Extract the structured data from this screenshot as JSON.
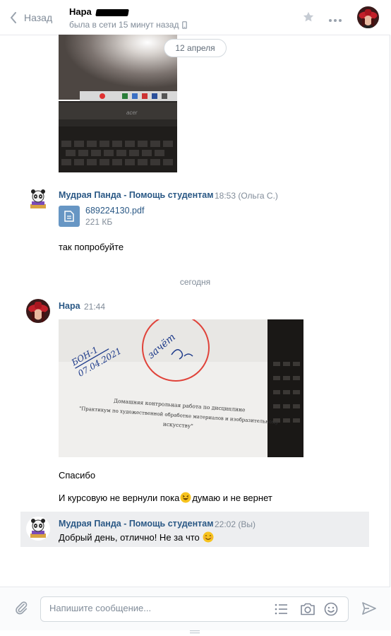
{
  "header": {
    "back_label": "Назад",
    "peer_name": "Нара",
    "peer_status": "была в сети 15 минут назад"
  },
  "messages": {
    "date_label_april": "12 апреля",
    "panda_sender": "Мудрая Панда - Помощь студентам",
    "panda_time_1": "18:53 (Ольга С.)",
    "doc_name": "689224130.pdf",
    "doc_size": "221 КБ",
    "panda_text_1": "так попробуйте",
    "day_separator": "сегодня",
    "nara_sender": "Нара",
    "nara_time": "21:44",
    "photo_text_line1": "Домашняя контрольная работа по дисциплине",
    "photo_text_line2": "\"Практикум по художественной обработке материалов и изобразительному",
    "photo_text_line3": "искусству\"",
    "photo_hand_1": "БОН-1",
    "photo_hand_2": "07.04.2021",
    "photo_hand_3": "зачёт",
    "nara_text_1": "Спасибо",
    "nara_text_2": "И курсовую не вернули пока",
    "nara_text_2b": "думаю и не вернет",
    "panda_time_2": "22:02 (Вы)",
    "panda_text_2": "Добрый день, отлично! Не за что"
  },
  "composer": {
    "placeholder": "Напишите сообщение..."
  },
  "icons": [
    "chevron-left-icon",
    "phone-icon",
    "star-icon",
    "more-icon",
    "document-icon",
    "attach-icon",
    "list-icon",
    "camera-icon",
    "smile-icon",
    "send-icon",
    "resize-icon",
    "emoji-laugh-icon",
    "emoji-smile-icon"
  ],
  "colors": {
    "link": "#2a5885",
    "muted": "#818c99",
    "highlight": "#edeef0",
    "doc_icon": "#6796c4"
  }
}
